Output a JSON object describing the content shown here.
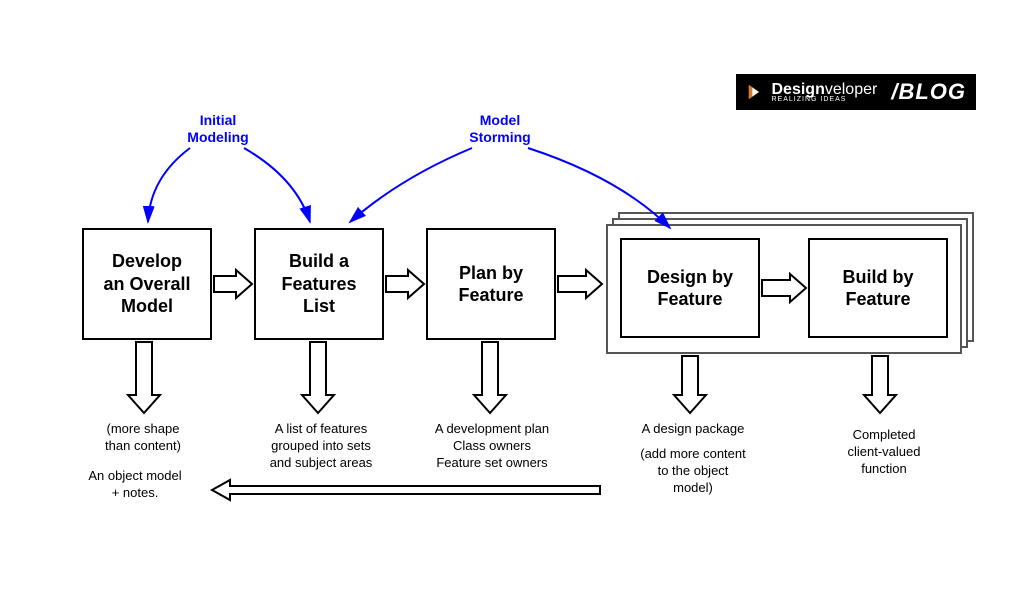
{
  "logo": {
    "brand_prefix": "Design",
    "brand_suffix": "veloper",
    "tagline": "REALIZING IDEAS",
    "blog": "/BLOG"
  },
  "annotations": {
    "initial_modeling": "Initial\nModeling",
    "model_storming": "Model\nStorming"
  },
  "boxes": {
    "develop": "Develop\nan Overall\nModel",
    "build_list": "Build a\nFeatures\nList",
    "plan": "Plan by\nFeature",
    "design": "Design by\nFeature",
    "build": "Build by\nFeature"
  },
  "outputs": {
    "develop_1": "(more shape\nthan content)",
    "develop_2": "An object model\n+ notes.",
    "build_list": "A list of features\ngrouped into sets\nand subject areas",
    "plan": "A development plan\nClass owners\nFeature set owners",
    "design_1": "A design package",
    "design_2": "(add more content\nto the object\nmodel)",
    "build": "Completed\nclient-valued\nfunction"
  },
  "colors": {
    "annotation": "#0000ff",
    "box_border": "#000000",
    "arrow": "#000000"
  }
}
